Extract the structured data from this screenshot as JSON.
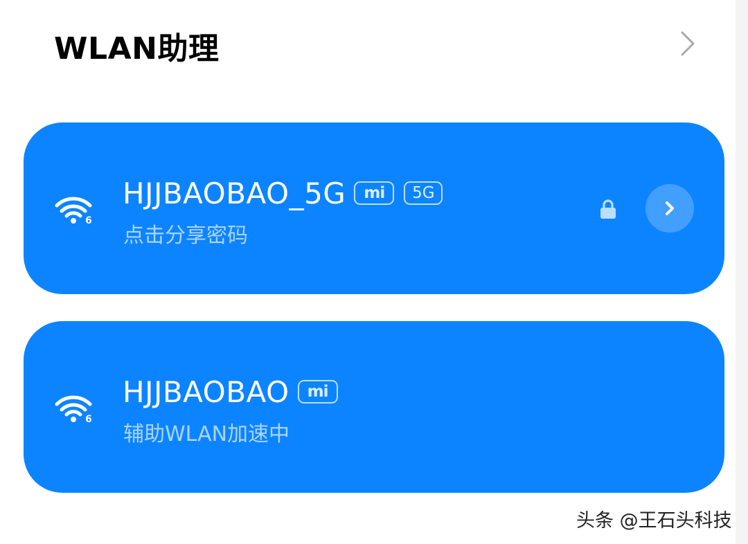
{
  "header": {
    "title": "WLAN助理",
    "chevron_icon": "chevron-right-icon"
  },
  "networks": [
    {
      "ssid": "HJJBAOBAO_5G",
      "badges": [
        "mi",
        "5G"
      ],
      "subtitle": "点击分享密码",
      "wifi_icon": "wifi-6-icon",
      "secured": true,
      "action_icon": "chevron-right-icon"
    },
    {
      "ssid": "HJJBAOBAO",
      "badges": [
        "mi"
      ],
      "subtitle": "辅助WLAN加速中",
      "wifi_icon": "wifi-6-icon"
    }
  ],
  "watermark": "头条 @王石头科技",
  "colors": {
    "card": "#0d84ff",
    "background": "#ffffff"
  }
}
